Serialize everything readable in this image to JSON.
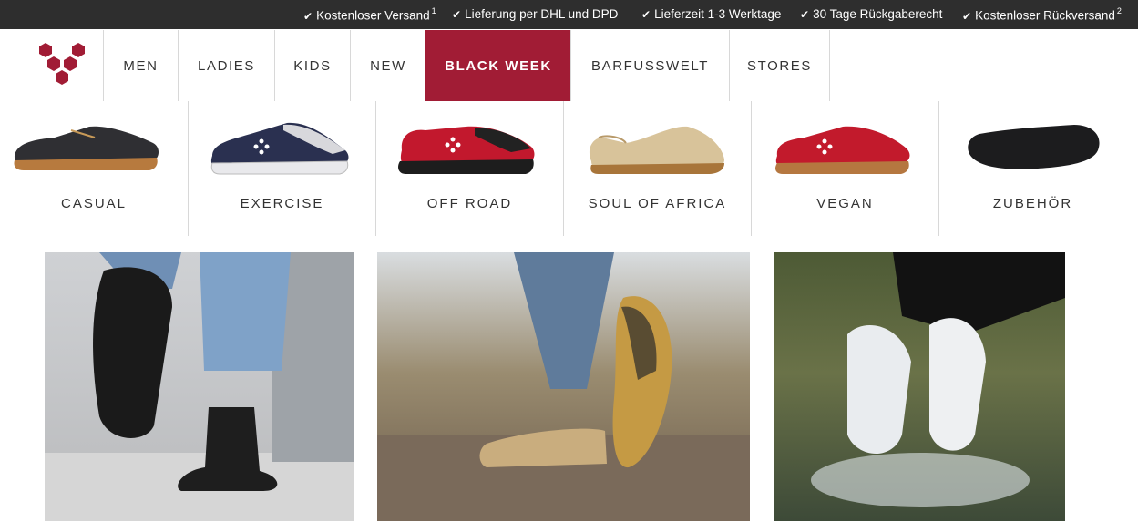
{
  "top_bar": {
    "usps": [
      {
        "text": "Kostenloser Versand",
        "sup": "1"
      },
      {
        "text": "Lieferung per DHL und DPD",
        "sup": ""
      },
      {
        "text": "Lieferzeit 1-3 Werktage",
        "sup": ""
      },
      {
        "text": "30 Tage Rückgaberecht",
        "sup": ""
      },
      {
        "text": "Kostenloser Rückversand",
        "sup": "2"
      }
    ],
    "check_icon": "✔"
  },
  "brand": {
    "logo_icon": "hexagon-cluster-logo",
    "color": "#a11c35"
  },
  "nav": {
    "items": [
      {
        "label": "MEN"
      },
      {
        "label": "LADIES"
      },
      {
        "label": "KIDS"
      },
      {
        "label": "NEW"
      },
      {
        "label": "BLACK WEEK",
        "active": true
      },
      {
        "label": "BARFUSSWELT"
      },
      {
        "label": "STORES"
      }
    ]
  },
  "categories": [
    {
      "label": "CASUAL"
    },
    {
      "label": "EXERCISE"
    },
    {
      "label": "OFF ROAD"
    },
    {
      "label": "SOUL OF AFRICA"
    },
    {
      "label": "VEGAN"
    },
    {
      "label": "ZUBEHÖR"
    }
  ],
  "colors": {
    "accent": "#a11c35",
    "topbar": "#2e2e2e"
  }
}
